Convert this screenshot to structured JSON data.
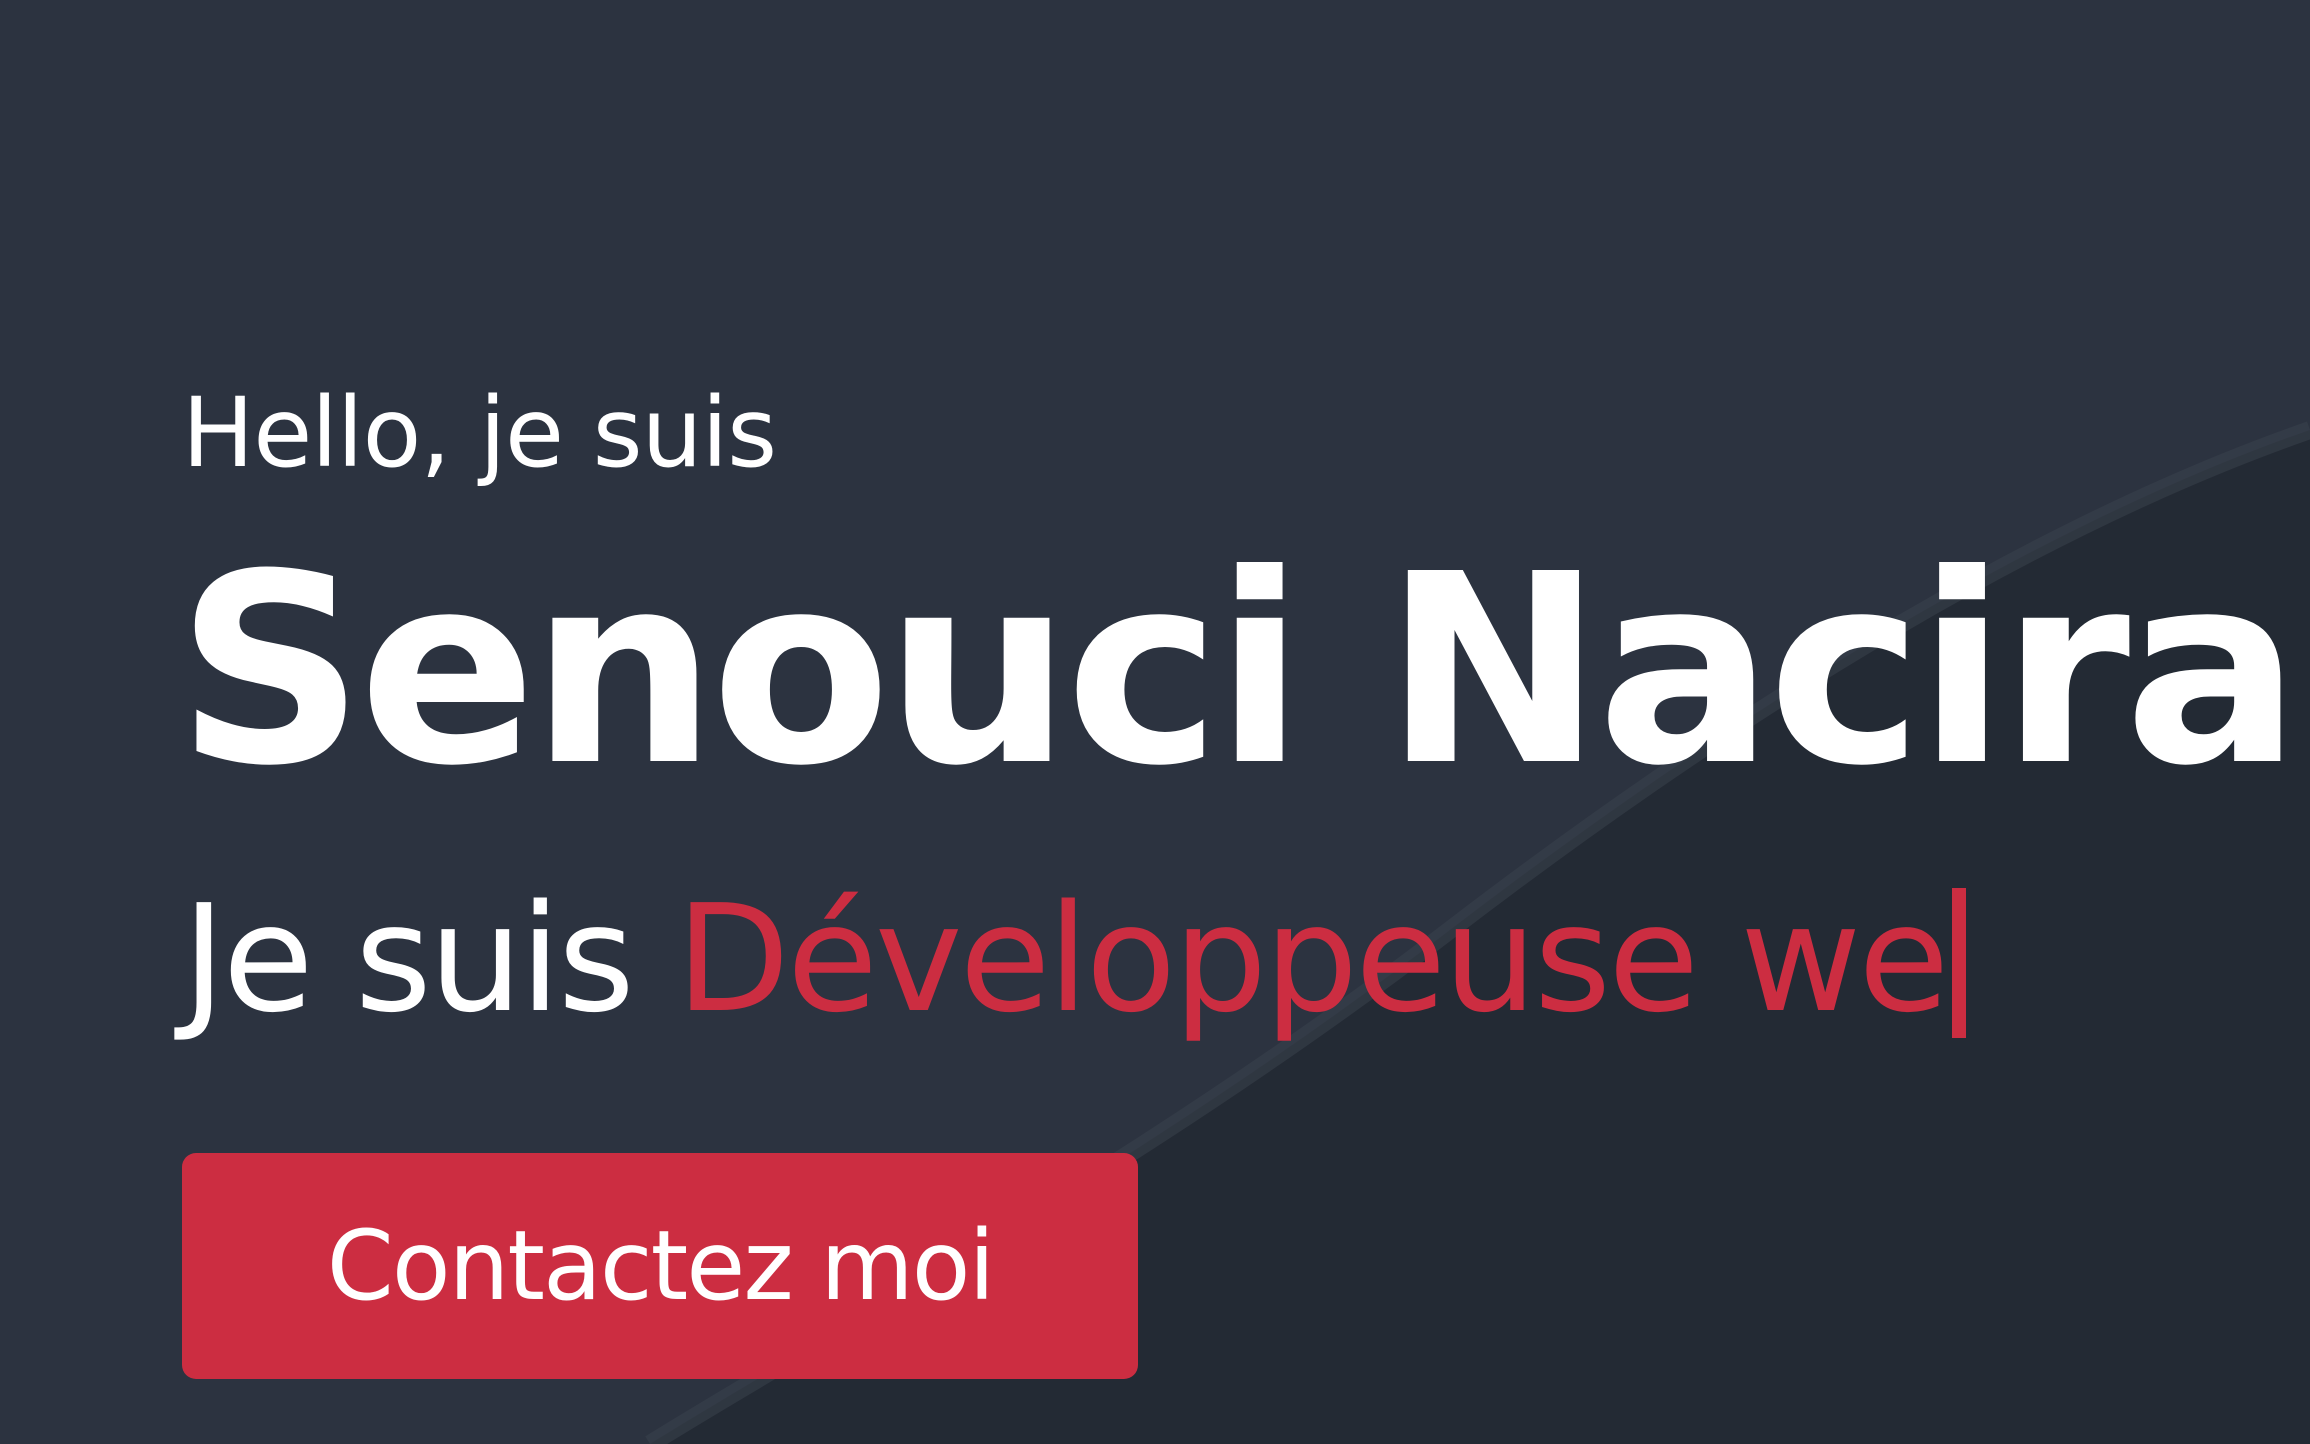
{
  "hero": {
    "greeting": "Hello, je suis",
    "name": "Senouci Nacira",
    "tagline_prefix": "Je suis ",
    "tagline_typed": "Développeuse we",
    "button_label": "Contactez moi"
  },
  "colors": {
    "background": "#2c3340",
    "accent": "#cc2d41",
    "text": "#ffffff"
  }
}
